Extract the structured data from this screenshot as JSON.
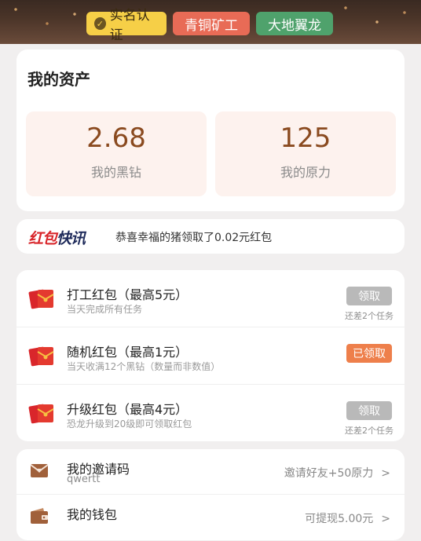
{
  "header": {
    "badges": [
      {
        "label": "实名认证",
        "icon": "verified-check-icon",
        "color": "#f6cf47"
      },
      {
        "label": "青铜矿工",
        "color": "#e86b56"
      },
      {
        "label": "大地翼龙",
        "color": "#4fa26c"
      }
    ]
  },
  "assets": {
    "title": "我的资产",
    "items": [
      {
        "value": "2.68",
        "label": "我的黑钻"
      },
      {
        "value": "125",
        "label": "我的原力"
      }
    ]
  },
  "news": {
    "logo_part1": "红包",
    "logo_part2": "快讯",
    "text": "恭喜幸福的猪领取了0.02元红包"
  },
  "tasks": [
    {
      "name": "打工红包（最高5元）",
      "desc": "当天完成所有任务",
      "button": "领取",
      "status": "disabled",
      "remain": "还差2个任务",
      "icon": "red-envelope-icon"
    },
    {
      "name": "随机红包（最高1元）",
      "desc": "当天收满12个黑钻（数量而非数值）",
      "button": "已领取",
      "status": "claimed",
      "remain": "",
      "icon": "red-envelope-icon"
    },
    {
      "name": "升级红包（最高4元）",
      "desc": "恐龙升级到20级即可领取红包",
      "button": "领取",
      "status": "disabled",
      "remain": "还差2个任务",
      "icon": "red-envelope-icon"
    }
  ],
  "extras": [
    {
      "name": "我的邀请码",
      "sub": "qwertt",
      "right": "邀请好友+50原力",
      "chevron": ">",
      "icon": "invite-mail-icon"
    },
    {
      "name": "我的钱包",
      "sub": "",
      "right": "可提现5.00元",
      "chevron": ">",
      "icon": "wallet-icon"
    }
  ],
  "colors": {
    "accent_orange": "#ee7f4b",
    "value_brown": "#8a4a1f",
    "disabled_grey": "#b9b9b9"
  }
}
